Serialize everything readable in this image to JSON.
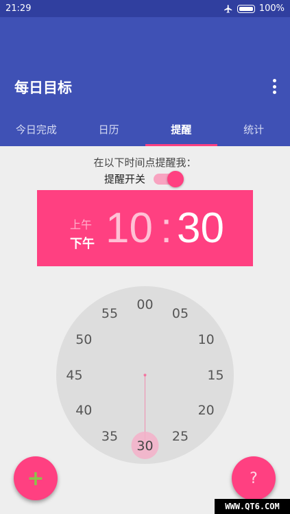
{
  "status_bar": {
    "time": "21:29",
    "battery_percent": "100%",
    "battery_level": 1.0
  },
  "app_bar": {
    "title": "每日目标"
  },
  "tabs": [
    {
      "label": "今日完成",
      "active": false
    },
    {
      "label": "日历",
      "active": false
    },
    {
      "label": "提醒",
      "active": true
    },
    {
      "label": "统计",
      "active": false
    }
  ],
  "reminder": {
    "prompt": "在以下时间点提醒我：",
    "toggle_label": "提醒开关",
    "toggle_on": true
  },
  "time_display": {
    "am": "上午",
    "pm": "下午",
    "hour": "10",
    "colon": ":",
    "minute": "30",
    "selected_period": "pm"
  },
  "clock": {
    "numbers": [
      "00",
      "05",
      "10",
      "15",
      "20",
      "25",
      "30",
      "35",
      "40",
      "45",
      "50",
      "55"
    ],
    "selected": "30"
  },
  "fabs": {
    "add_label": "+",
    "help_label": "?"
  },
  "watermark": "WWW.QT6.COM",
  "colors": {
    "primary": "#3f51b5",
    "primary_dark": "#303f9f",
    "accent": "#ff4081"
  }
}
